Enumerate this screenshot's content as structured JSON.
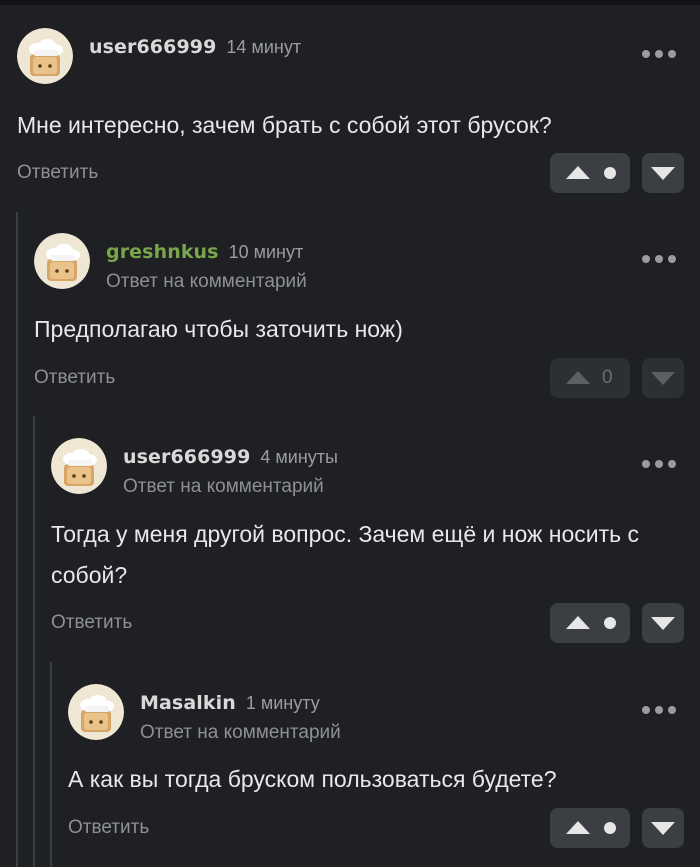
{
  "comments": [
    {
      "username": "user666999",
      "time": "14 минут",
      "reply_note": "",
      "text": "Мне интересно, зачем брать с собой этот брусок?",
      "reply_label": "Ответить",
      "score": ""
    },
    {
      "username": "greshnkus",
      "time": "10 минут",
      "reply_note": "Ответ на комментарий",
      "text": "Предполагаю чтобы заточить нож)",
      "reply_label": "Ответить",
      "score": "0"
    },
    {
      "username": "user666999",
      "time": "4 минуты",
      "reply_note": "Ответ на комментарий",
      "text": "Тогда у меня другой вопрос. Зачем ещё и нож носить с собой?",
      "reply_label": "Ответить",
      "score": ""
    },
    {
      "username": "Masalkin",
      "time": "1 минуту",
      "reply_note": "Ответ на комментарий",
      "text": "А как вы тогда бруском пользоваться будете?",
      "reply_label": "Ответить",
      "score": ""
    }
  ],
  "colors": {
    "background": "#1e2024",
    "username": "#d9d9d9",
    "highlighted_username": "#7aa54a",
    "muted_text": "#8e9094",
    "vote_button": "#3b3e43"
  },
  "icons": {
    "avatar": "chef-hat-toast-avatar",
    "more": "more-dots-icon",
    "upvote": "arrow-up-icon",
    "downvote": "arrow-down-icon"
  }
}
